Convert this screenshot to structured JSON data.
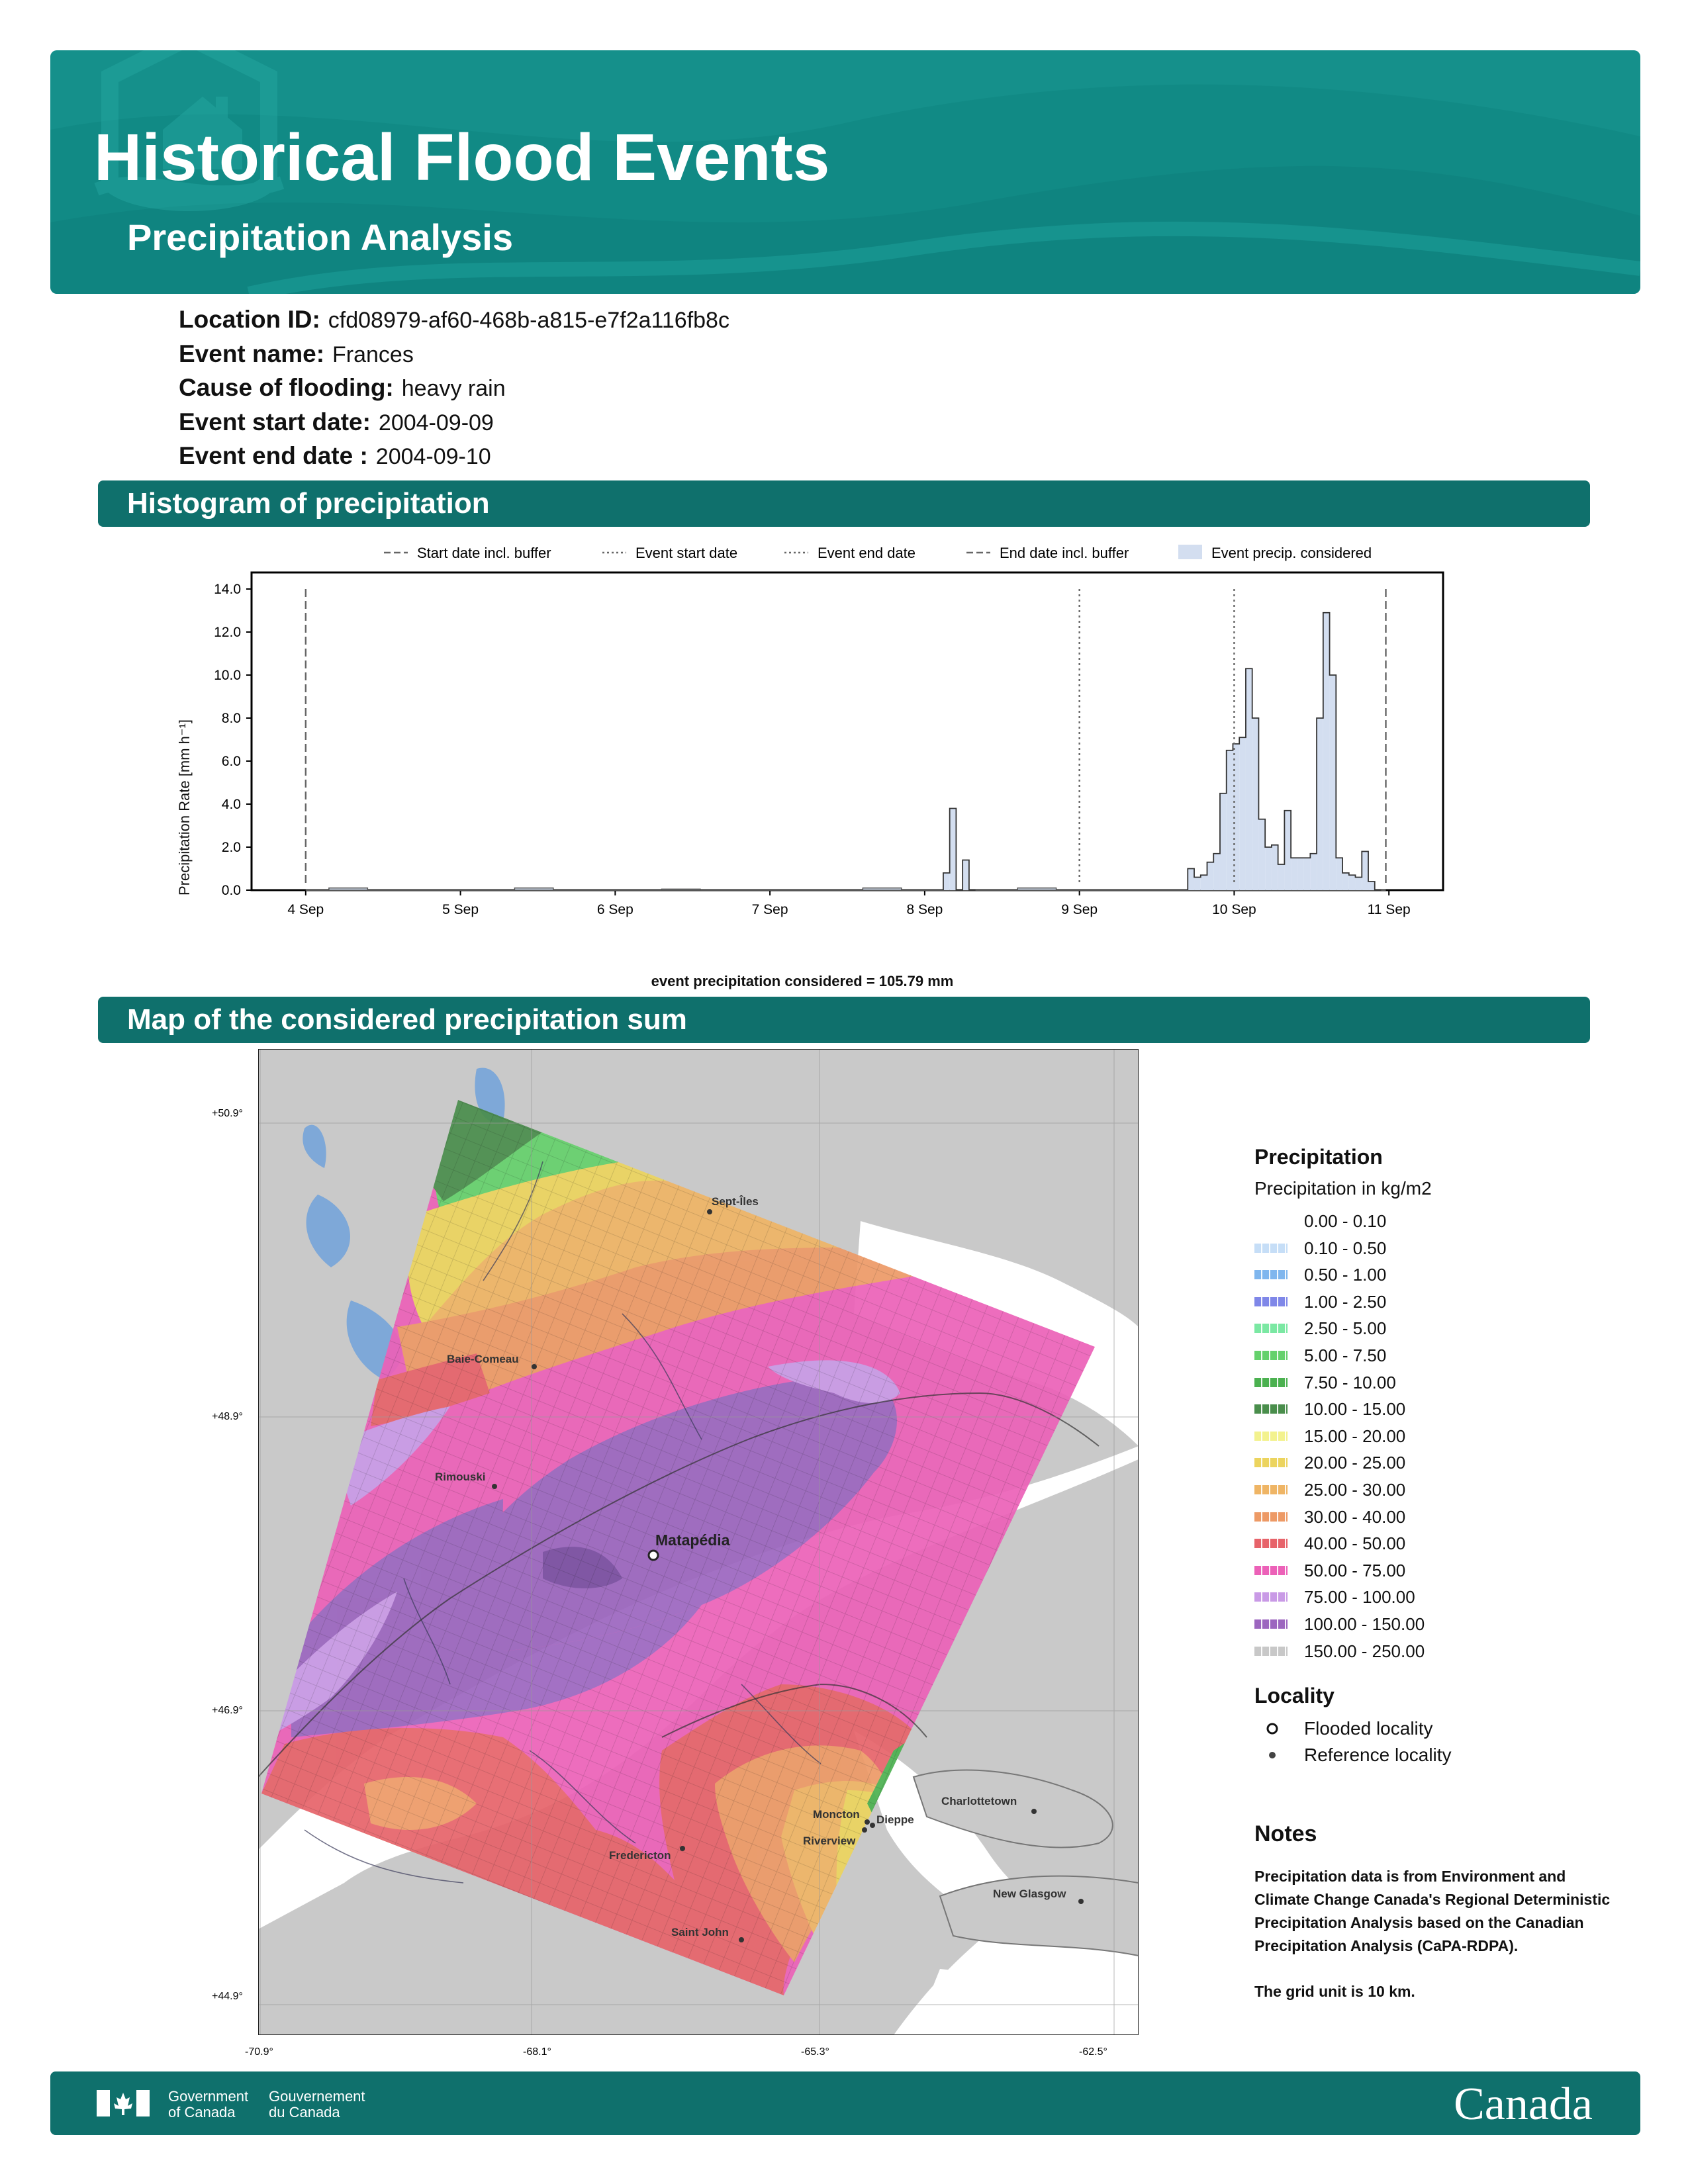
{
  "header": {
    "title": "Historical Flood Events",
    "subtitle": "Precipitation Analysis",
    "icon": "house-flood-logo-icon",
    "color": "#118a85"
  },
  "event_info": [
    {
      "label": "Location ID:",
      "value": "cfd08979-af60-468b-a815-e7f2a116fb8c"
    },
    {
      "label": "Event name:",
      "value": "Frances"
    },
    {
      "label": "Cause of flooding:",
      "value": "heavy rain"
    },
    {
      "label": "Event start date:",
      "value": "2004-09-09"
    },
    {
      "label": "Event end date :",
      "value": "2004-09-10"
    }
  ],
  "sections": {
    "histogram": "Histogram of precipitation",
    "map": "Map of the considered precipitation sum"
  },
  "chart_data": {
    "type": "bar",
    "xlabel": "event precipitation considered = 105.79 mm",
    "ylabel": "Precipitation Rate [mm h⁻¹]",
    "ylim": [
      0,
      14
    ],
    "yticks": [
      "0.0",
      "2.0",
      "4.0",
      "6.0",
      "8.0",
      "10.0",
      "12.0",
      "14.0"
    ],
    "xticks": [
      "4 Sep",
      "5 Sep",
      "6 Sep",
      "7 Sep",
      "8 Sep",
      "9 Sep",
      "10 Sep",
      "11 Sep"
    ],
    "xlim_days": [
      3.65,
      11.35
    ],
    "legend": [
      {
        "label": "Start date incl. buffer",
        "style": "dashed"
      },
      {
        "label": "Event start date",
        "style": "dotted"
      },
      {
        "label": "Event end date",
        "style": "dotted"
      },
      {
        "label": "End date incl. buffer",
        "style": "dashed"
      },
      {
        "label": "Event precip. considered",
        "style": "fill"
      }
    ],
    "legend_position": "top",
    "vlines": [
      {
        "day": 4.0,
        "style": "dashed"
      },
      {
        "day": 9.0,
        "style": "dotted"
      },
      {
        "day": 10.0,
        "style": "dotted"
      },
      {
        "day": 10.98,
        "style": "dashed"
      }
    ],
    "fill_color": "#d3def0",
    "series": [
      {
        "start_day": 9.7,
        "step_hours": 1,
        "values": [
          1.0,
          0.6,
          0.7,
          1.3,
          1.7,
          4.5,
          6.5,
          6.8,
          7.1,
          10.3,
          8.0,
          3.3,
          2.0,
          2.1,
          1.2,
          3.7,
          1.5,
          1.5,
          1.5,
          1.7,
          8.0,
          12.9,
          10.0,
          1.5,
          0.8,
          0.7,
          0.6,
          1.8,
          0.4,
          0.0
        ]
      },
      {
        "start_day": 8.12,
        "step_hours": 1,
        "values": [
          0.8,
          3.8,
          0.0,
          1.4,
          0.0
        ]
      }
    ],
    "background_bumps": [
      {
        "day": 4.15,
        "value": 0.1
      },
      {
        "day": 5.35,
        "value": 0.1
      },
      {
        "day": 6.3,
        "value": 0.05
      },
      {
        "day": 7.6,
        "value": 0.1
      },
      {
        "day": 8.6,
        "value": 0.1
      }
    ]
  },
  "map": {
    "lat_labels": [
      "+50.9°",
      "+48.9°",
      "+46.9°",
      "+44.9°"
    ],
    "lon_labels": [
      "-70.9°",
      "-68.1°",
      "-65.3°",
      "-62.5°"
    ],
    "flooded_locality": "Matapédia",
    "reference_localities": [
      "Sept-Îles",
      "Baie-Comeau",
      "Rimouski",
      "Charlottetown",
      "Moncton",
      "Dieppe",
      "Riverview",
      "Fredericton",
      "New Glasgow",
      "Saint John"
    ]
  },
  "legend": {
    "title": "Precipitation",
    "subtitle": "Precipitation in kg/m2",
    "classes": [
      {
        "label": "0.00 - 0.10",
        "color": "#ffffff"
      },
      {
        "label": "0.10 - 0.50",
        "color": "#c6def7"
      },
      {
        "label": "0.50 - 1.00",
        "color": "#7fb6ee"
      },
      {
        "label": "1.00 - 2.50",
        "color": "#7f87e8"
      },
      {
        "label": "2.50 - 5.00",
        "color": "#7be8a3"
      },
      {
        "label": "5.00 - 7.50",
        "color": "#65d16c"
      },
      {
        "label": "7.50 - 10.00",
        "color": "#4bb150"
      },
      {
        "label": "10.00 - 15.00",
        "color": "#4a8e4c"
      },
      {
        "label": "15.00 - 20.00",
        "color": "#f3f28e"
      },
      {
        "label": "20.00 - 25.00",
        "color": "#ecd45e"
      },
      {
        "label": "25.00 - 30.00",
        "color": "#efb565"
      },
      {
        "label": "30.00 - 40.00",
        "color": "#ed9a66"
      },
      {
        "label": "40.00 - 50.00",
        "color": "#e7636a"
      },
      {
        "label": "50.00 - 75.00",
        "color": "#ec61b8"
      },
      {
        "label": "75.00 - 100.00",
        "color": "#c99ae6"
      },
      {
        "label": "100.00 - 150.00",
        "color": "#9c66bf"
      },
      {
        "label": "150.00 - 250.00",
        "color": "#c8c8c8"
      }
    ],
    "locality_title": "Locality",
    "flooded_label": "Flooded locality",
    "reference_label": "Reference locality"
  },
  "notes": {
    "title": "Notes",
    "paragraphs": [
      "Precipitation data is from Environment and Climate Change Canada's Regional Deterministic Precipitation Analysis based on the Canadian Precipitation Analysis (CaPA-RDPA).",
      "The grid unit is 10 km."
    ]
  },
  "footer": {
    "gov_en_1": "Government",
    "gov_en_2": "of Canada",
    "gov_fr_1": "Gouvernement",
    "gov_fr_2": "du Canada",
    "wordmark": "Canada",
    "flag_icon": "canada-flag-icon"
  }
}
